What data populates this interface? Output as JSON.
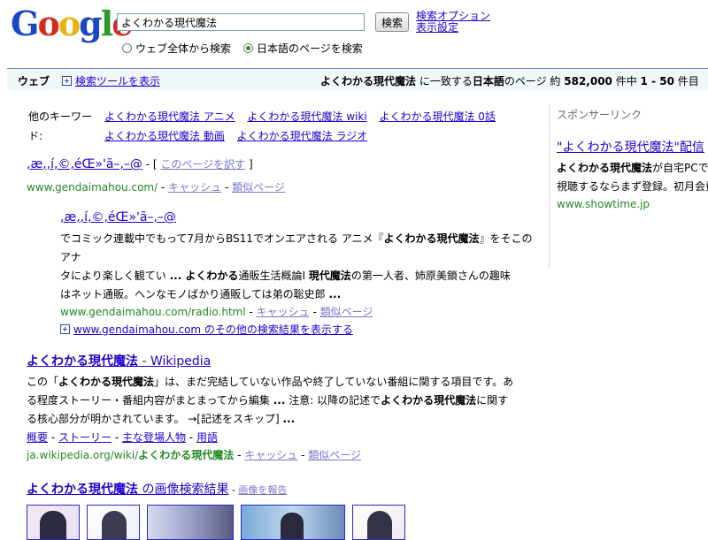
{
  "logo": {
    "text": "Google"
  },
  "search": {
    "query": "よくわかる現代魔法",
    "button": "検索"
  },
  "options": {
    "search_options": "検索オプション",
    "display_settings": "表示設定"
  },
  "radios": {
    "all_web": "ウェブ全体から検索",
    "japanese": "日本語のページを検索",
    "selected": "japanese"
  },
  "bar": {
    "web_label": "ウェブ",
    "tools_label": "検索ツールを表示",
    "query": "よくわかる現代魔法",
    "match": " に一致する",
    "lang": "日本語",
    "pages": "のページ 約 ",
    "total": "582,000",
    "mid": " 件中 ",
    "range": "1 - 50",
    "end": " 件目"
  },
  "keywords": {
    "label": "他のキーワード:",
    "items": [
      "よくわかる現代魔法 アニメ",
      "よくわかる現代魔法 wiki",
      "よくわかる現代魔法 0話",
      "よくわかる現代魔法 動画",
      "よくわかる現代魔法 ラジオ"
    ]
  },
  "results": {
    "r1": {
      "title": ",æ,,í,©,éŒ»'ã–,–@",
      "translate_prefix": " - [ ",
      "translate": "このページを訳す",
      "translate_suffix": " ]",
      "url": "www.gendaimahou.com/",
      "cache": "キャッシュ",
      "similar": "類似ページ",
      "sep": " - "
    },
    "r1sub": {
      "title": ",æ,,í,©,éŒ»'ã–,–@",
      "snippet_line1_a": "でコミック連載中でもって7月からBS11でオンエアされる アニメ『",
      "snippet_line1_b": "よくわかる現代魔法",
      "snippet_line1_c": "』をそこのアナ",
      "snippet_line2_a": "タにより楽しく観てい ",
      "snippet_line2_b": "... よくわかる",
      "snippet_line2_c": "通販生活概論Ⅰ ",
      "snippet_line2_d": "現代魔法",
      "snippet_line2_e": "の第一人者、姉原美鎖さんの趣味",
      "snippet_line3": "はネット通販。ヘンなモノばかり通販しては弟の聡史郎 ",
      "snippet_line3_b": "...",
      "url": "www.gendaimahou.com/radio.html",
      "cache": "キャッシュ",
      "similar": "類似ページ"
    },
    "r1more": {
      "text": "www.gendaimahou.com のその他の検索結果を表示する"
    },
    "r2": {
      "title_bold": "よくわかる現代魔法",
      "title_rest": " - Wikipedia",
      "s1_a": "この「",
      "s1_b": "よくわかる現代魔法",
      "s1_c": "」は、まだ完結していない作品や終了していない番組に関する項目です。あ",
      "s2_a": "る程度ストーリー・番組内容がまとまってから編集 ",
      "s2_b": "...",
      "s2_c": " 注意: 以降の記述で",
      "s2_d": "よくわかる現代魔法",
      "s2_e": "に関す",
      "s3_a": "る核心部分が明かされています。 →[記述をスキップ] ",
      "s3_b": "...",
      "sub_links": [
        "概要",
        "ストーリー",
        "主な登場人物",
        "用語"
      ],
      "url_a": "ja.wikipedia.org/wiki/",
      "url_b": "よくわかる現代魔法",
      "cache": "キャッシュ",
      "similar": "類似ページ"
    },
    "r3": {
      "title_bold": "よくわかる現代魔法",
      "title_rest": " の画像検索結果",
      "report": "画像を報告"
    }
  },
  "ads": {
    "header": "スポンサーリンク",
    "title": "\"よくわかる現代魔法\"配信",
    "line1_a": "よくわかる現代魔法",
    "line1_b": "が自宅PCで",
    "line2": "視聴するならまず登録。初月会費",
    "url": "www.showtime.jp"
  },
  "colors": {
    "link": "#2200cc",
    "url_green": "#228822",
    "bar_border": "#6b90da",
    "bar_bg": "#f0f7f9"
  }
}
